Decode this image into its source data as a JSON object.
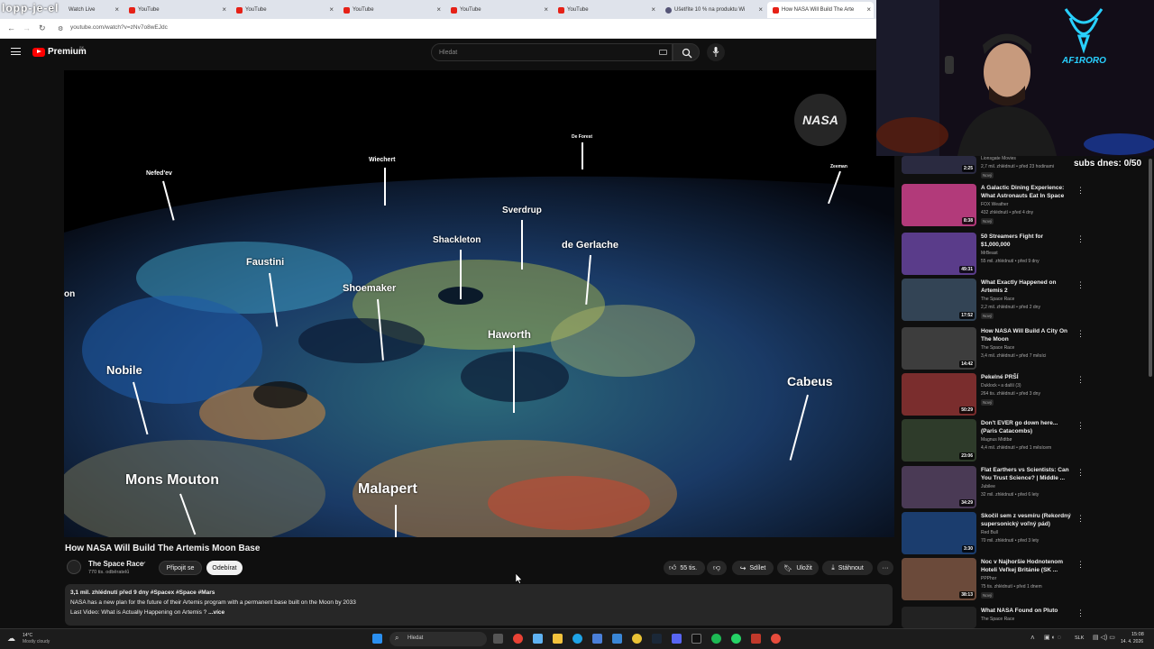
{
  "browser": {
    "overlay_text": "lopp-je-el",
    "tabs": [
      {
        "label": "Watch Live"
      },
      {
        "label": "YouTube"
      },
      {
        "label": "YouTube"
      },
      {
        "label": "YouTube"
      },
      {
        "label": "YouTube"
      },
      {
        "label": "YouTube"
      },
      {
        "label": "Ušetříte 10 % na produktu Wi"
      },
      {
        "label": "How NASA Will Build The Arte"
      }
    ],
    "url": "youtube.com/watch?v=zNv7o8wEJdc"
  },
  "header": {
    "brand": "Premium",
    "brand_suffix": "SK",
    "search_placeholder": "Hledat"
  },
  "video": {
    "logo_text": "NASA",
    "map_labels": [
      "Nefed'ev",
      "Wiechert",
      "De Forest",
      "Zeeman",
      "Sverdrup",
      "Shackleton",
      "de Gerlache",
      "Faustini",
      "Shoemaker",
      "Haworth",
      "Nobile",
      "Cabeus",
      "Mons Mouton",
      "Malapert",
      "on"
    ]
  },
  "meta": {
    "title": "How NASA Will Build The Artemis Moon Base",
    "channel": "The Space Race",
    "subs": "770 tis. odběratelů",
    "join_label": "Připojit se",
    "subscribe_label": "Odebírat",
    "likes": "55 tis.",
    "share_label": "Sdílet",
    "save_label": "Uložit",
    "download_label": "Stáhnout"
  },
  "description": {
    "stats": "3,1 mil. zhlédnutí  před 9 dny  #Spacex #Space #Mars",
    "line1": "NASA has a new plan for the future of their Artemis program with a permanent base built on the Moon by 2033",
    "line2": "Last Video: What is Actually Happening on Artemis ?",
    "more": "...více"
  },
  "overlay": {
    "subs_counter": "subs dnes: 0/50"
  },
  "sidebar": [
    {
      "title": "",
      "channel": "Lionsgate Movies",
      "stats": "2,7 mil. zhlédnutí • před 23 hodinami",
      "badge": "Nový",
      "duration": "2:25",
      "thumb": "#2a2a40"
    },
    {
      "title": "A Galactic Dining Experience: What Astronauts Eat In Space",
      "channel": "FOX Weather",
      "stats": "432 zhlédnutí • před 4 dny",
      "badge": "Nový",
      "duration": "8:38",
      "thumb": "#b23a7a"
    },
    {
      "title": "50 Streamers Fight for $1,000,000",
      "channel": "MrBeast",
      "stats": "55 mil. zhlédnutí • před 9 dny",
      "badge": "",
      "duration": "49:31",
      "thumb": "#5a3c8a"
    },
    {
      "title": "What Exactly Happened on Artemis 2",
      "channel": "The Space Race",
      "stats": "2,2 mil. zhlédnutí • před 2 dny",
      "badge": "Nový",
      "duration": "17:52",
      "thumb": "#334455"
    },
    {
      "title": "How NASA Will Build A City On The Moon",
      "channel": "The Space Race",
      "stats": "3,4 mil. zhlédnutí • před 7 měsíci",
      "badge": "",
      "duration": "14:42",
      "thumb": "#3d3d3d"
    },
    {
      "title": "Pekelné PRŠÍ",
      "channel": "Duklock • a další (3)",
      "stats": "264 tis. zhlédnutí • před 3 dny",
      "badge": "Nový",
      "duration": "50:29",
      "thumb": "#7a2d2d"
    },
    {
      "title": "Don't EVER go down here... (Paris Catacombs)",
      "channel": "Magnus Midtbø",
      "stats": "4,4 mil. zhlédnutí • před 1 měsícem",
      "badge": "",
      "duration": "23:06",
      "thumb": "#2e3b2a"
    },
    {
      "title": "Flat Earthers vs Scientists: Can You Trust Science? | Middle ...",
      "channel": "Jubilee",
      "stats": "32 mil. zhlédnutí • před 6 lety",
      "badge": "",
      "duration": "34:29",
      "thumb": "#4a3a55"
    },
    {
      "title": "Skočil sem z vesmíru (Rekordný supersonický voľný pád)",
      "channel": "Red Bull",
      "stats": "70 mil. zhlédnutí • před 3 lety",
      "badge": "",
      "duration": "3:30",
      "thumb": "#1b3d6e"
    },
    {
      "title": "Noc v Najhoršie Hodnotenom Hoteli Veľkej Británie (SK ...",
      "channel": "PPPhor",
      "stats": "75 tis. zhlédnutí • před 1 dnem",
      "badge": "Nový",
      "duration": "38:13",
      "thumb": "#6b4a3a"
    },
    {
      "title": "What NASA Found on Pluto",
      "channel": "The Space Race",
      "stats": "",
      "badge": "",
      "duration": "",
      "thumb": "#222"
    }
  ],
  "taskbar": {
    "weather": "14°C",
    "weather_desc": "Mostly cloudy",
    "search": "Hledat",
    "lang": "SLK",
    "time": "15:08",
    "date": "14. 4. 2026"
  }
}
